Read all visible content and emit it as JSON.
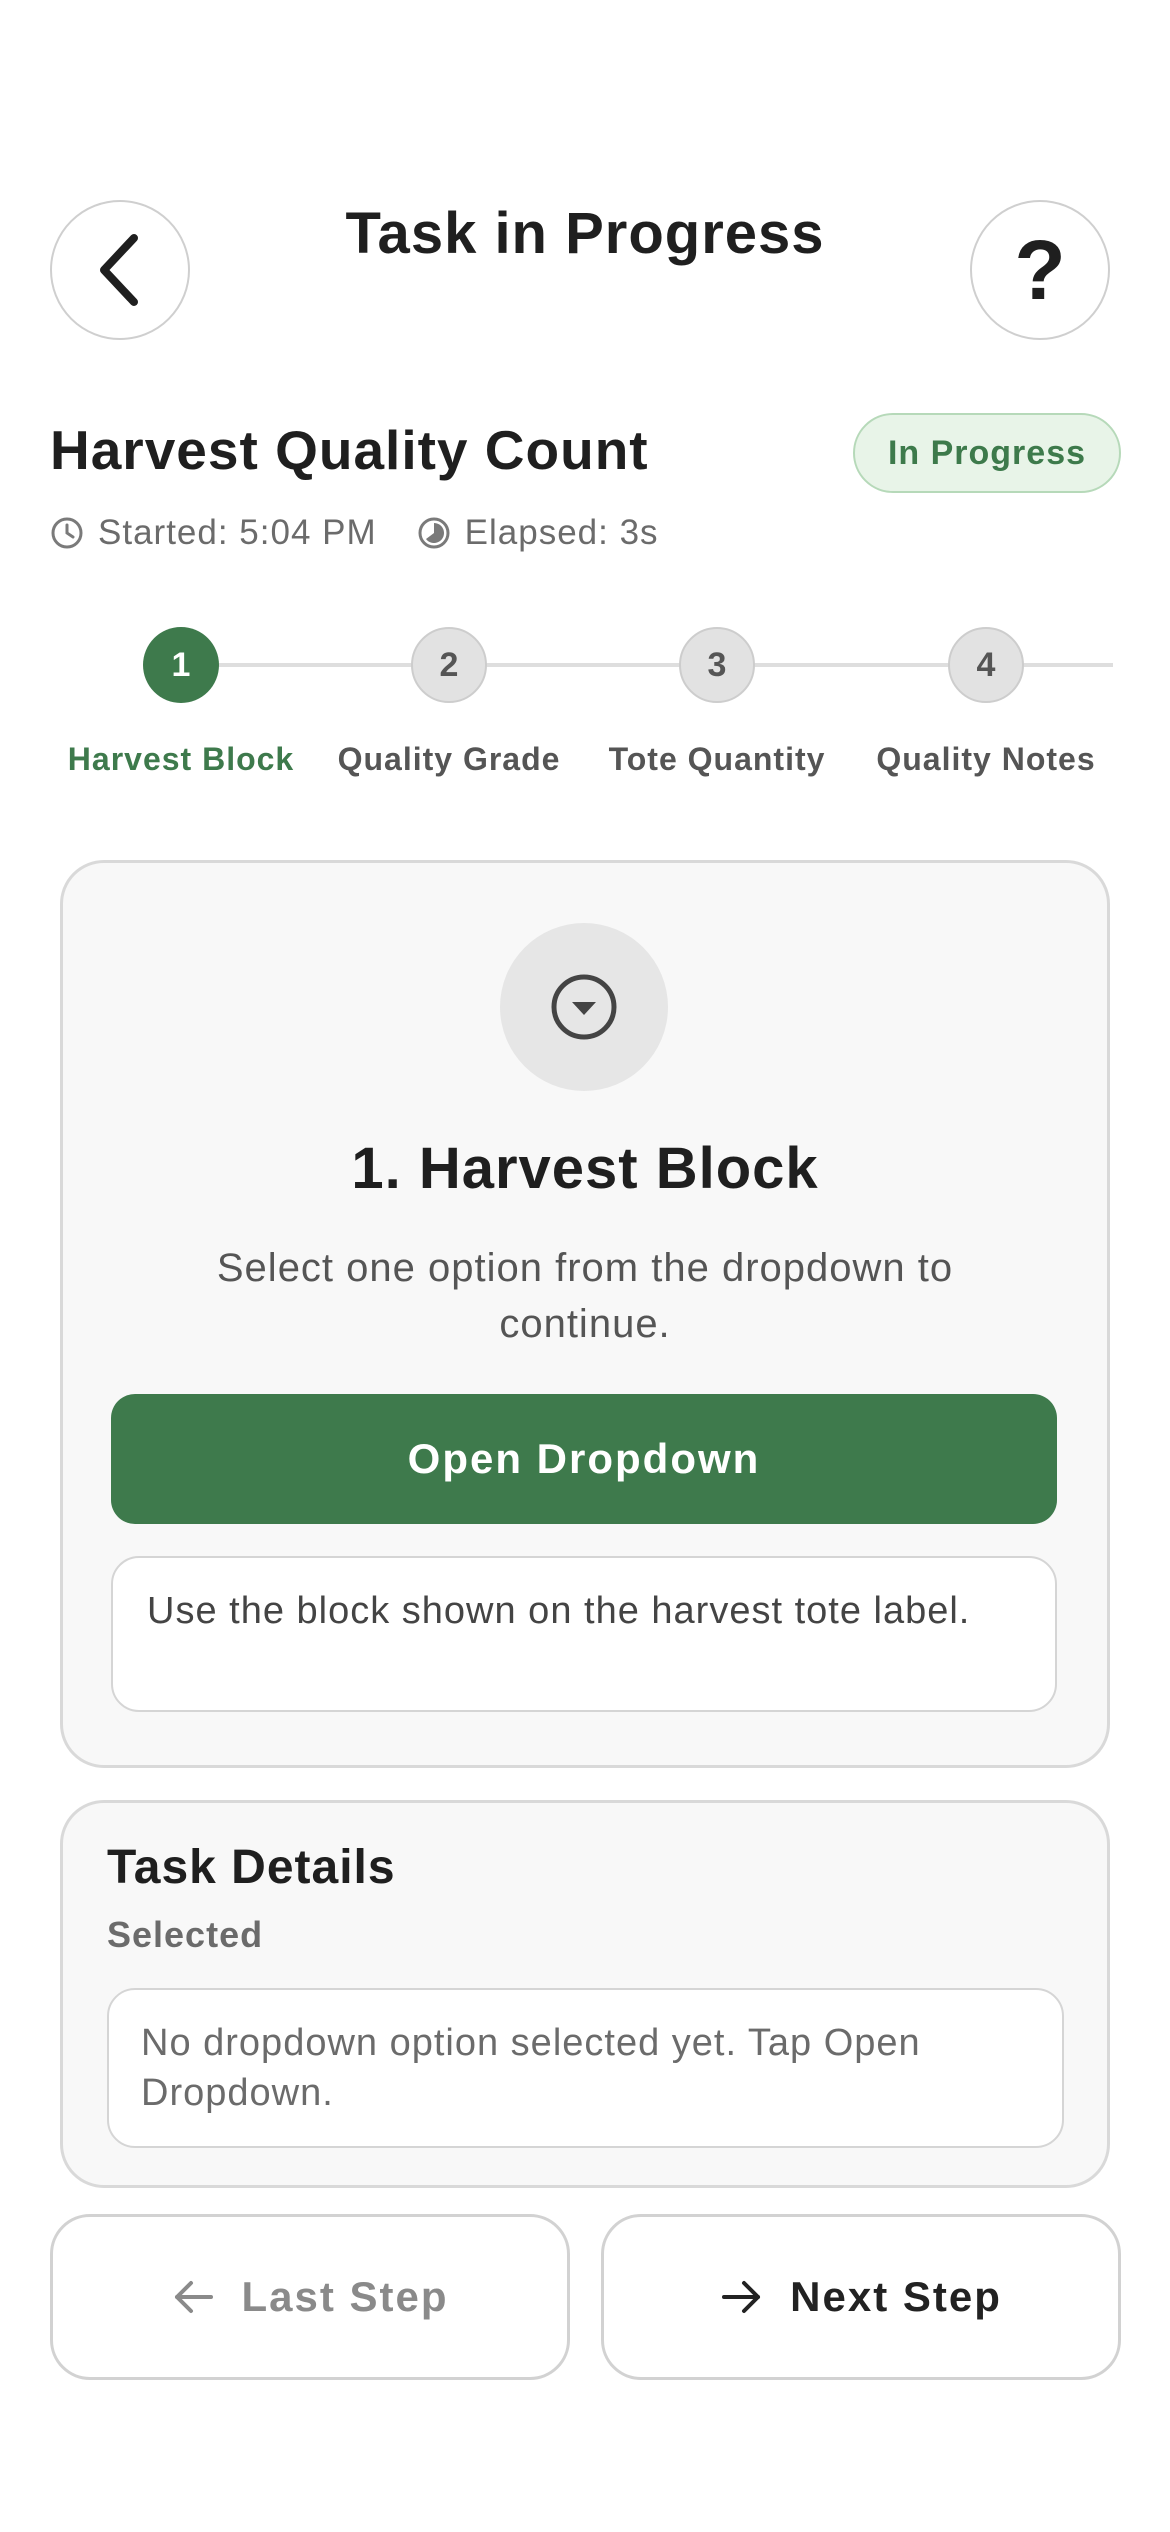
{
  "header": {
    "title": "Task in Progress",
    "back_icon": "chevron-left-icon",
    "help_icon": "question-mark-icon",
    "help_glyph": "?"
  },
  "task": {
    "name": "Harvest Quality Count",
    "status": "In Progress",
    "started_label": "Started: 5:04 PM",
    "elapsed_label": "Elapsed: 3s"
  },
  "steps": [
    {
      "number": "1",
      "label": "Harvest Block",
      "state": "active"
    },
    {
      "number": "2",
      "label": "Quality Grade",
      "state": "inactive"
    },
    {
      "number": "3",
      "label": "Tote Quantity",
      "state": "inactive"
    },
    {
      "number": "4",
      "label": "Quality Notes",
      "state": "inactive"
    }
  ],
  "current_step": {
    "icon": "dropdown-circle-icon",
    "heading": "1. Harvest Block",
    "description": "Select one option from the dropdown to continue.",
    "button_label": "Open Dropdown",
    "hint": "Use the block shown on the harvest tote label."
  },
  "details": {
    "title": "Task Details",
    "subtitle": "Selected",
    "selected_text": "No dropdown option selected yet. Tap Open Dropdown."
  },
  "navigation": {
    "prev_label": "Last Step",
    "next_label": "Next Step"
  },
  "colors": {
    "accent": "#3e7a4c",
    "badge_bg": "#e8f4e8",
    "card_bg": "#f8f8f8"
  }
}
